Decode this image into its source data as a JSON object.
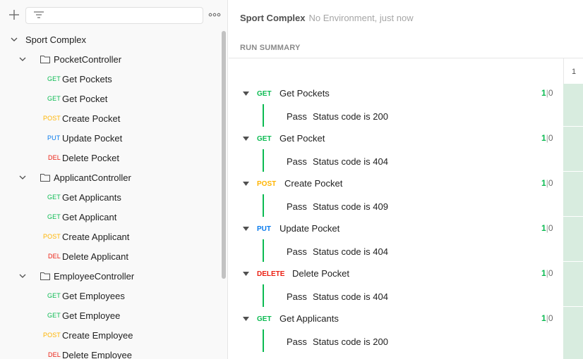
{
  "sidebar": {
    "collection": "Sport Complex",
    "folders": [
      {
        "name": "PocketController",
        "requests": [
          {
            "method": "GET",
            "name": "Get Pockets"
          },
          {
            "method": "GET",
            "name": "Get Pocket"
          },
          {
            "method": "POST",
            "name": "Create Pocket"
          },
          {
            "method": "PUT",
            "name": "Update Pocket"
          },
          {
            "method": "DEL",
            "name": "Delete Pocket"
          }
        ]
      },
      {
        "name": "ApplicantController",
        "requests": [
          {
            "method": "GET",
            "name": "Get Applicants"
          },
          {
            "method": "GET",
            "name": "Get Applicant"
          },
          {
            "method": "POST",
            "name": "Create Applicant"
          },
          {
            "method": "DEL",
            "name": "Delete Applicant"
          }
        ]
      },
      {
        "name": "EmployeeController",
        "requests": [
          {
            "method": "GET",
            "name": "Get Employees"
          },
          {
            "method": "GET",
            "name": "Get Employee"
          },
          {
            "method": "POST",
            "name": "Create Employee"
          },
          {
            "method": "DEL",
            "name": "Delete Employee"
          }
        ]
      }
    ]
  },
  "main": {
    "run_name": "Sport Complex",
    "run_meta": "No Environment, just now",
    "summary_label": "RUN SUMMARY",
    "iteration": "1",
    "requests": [
      {
        "method": "GET",
        "name": "Get Pockets",
        "passed": "1",
        "sep": "|",
        "failed": "0",
        "test_status": "Pass",
        "test_name": "Status code is 200"
      },
      {
        "method": "GET",
        "name": "Get Pocket",
        "passed": "1",
        "sep": "|",
        "failed": "0",
        "test_status": "Pass",
        "test_name": "Status code is 404"
      },
      {
        "method": "POST",
        "name": "Create Pocket",
        "passed": "1",
        "sep": "|",
        "failed": "0",
        "test_status": "Pass",
        "test_name": "Status code is 409"
      },
      {
        "method": "PUT",
        "name": "Update Pocket",
        "passed": "1",
        "sep": "|",
        "failed": "0",
        "test_status": "Pass",
        "test_name": "Status code is 404"
      },
      {
        "method": "DELETE",
        "name": "Delete Pocket",
        "passed": "1",
        "sep": "|",
        "failed": "0",
        "test_status": "Pass",
        "test_name": "Status code is 404"
      },
      {
        "method": "GET",
        "name": "Get Applicants",
        "passed": "1",
        "sep": "|",
        "failed": "0",
        "test_status": "Pass",
        "test_name": "Status code is 200"
      }
    ]
  },
  "colors": {
    "get": "#0cbb52",
    "post": "#ffb400",
    "put": "#097bed",
    "delete": "#eb2013",
    "pass_fill": "#d8ecdf"
  },
  "icons": {
    "new": "plus-icon",
    "filter": "filter-icon",
    "more": "more-horizontal-icon",
    "expand": "chevron-down-icon",
    "folder": "folder-icon",
    "collapse": "caret-down-icon"
  }
}
